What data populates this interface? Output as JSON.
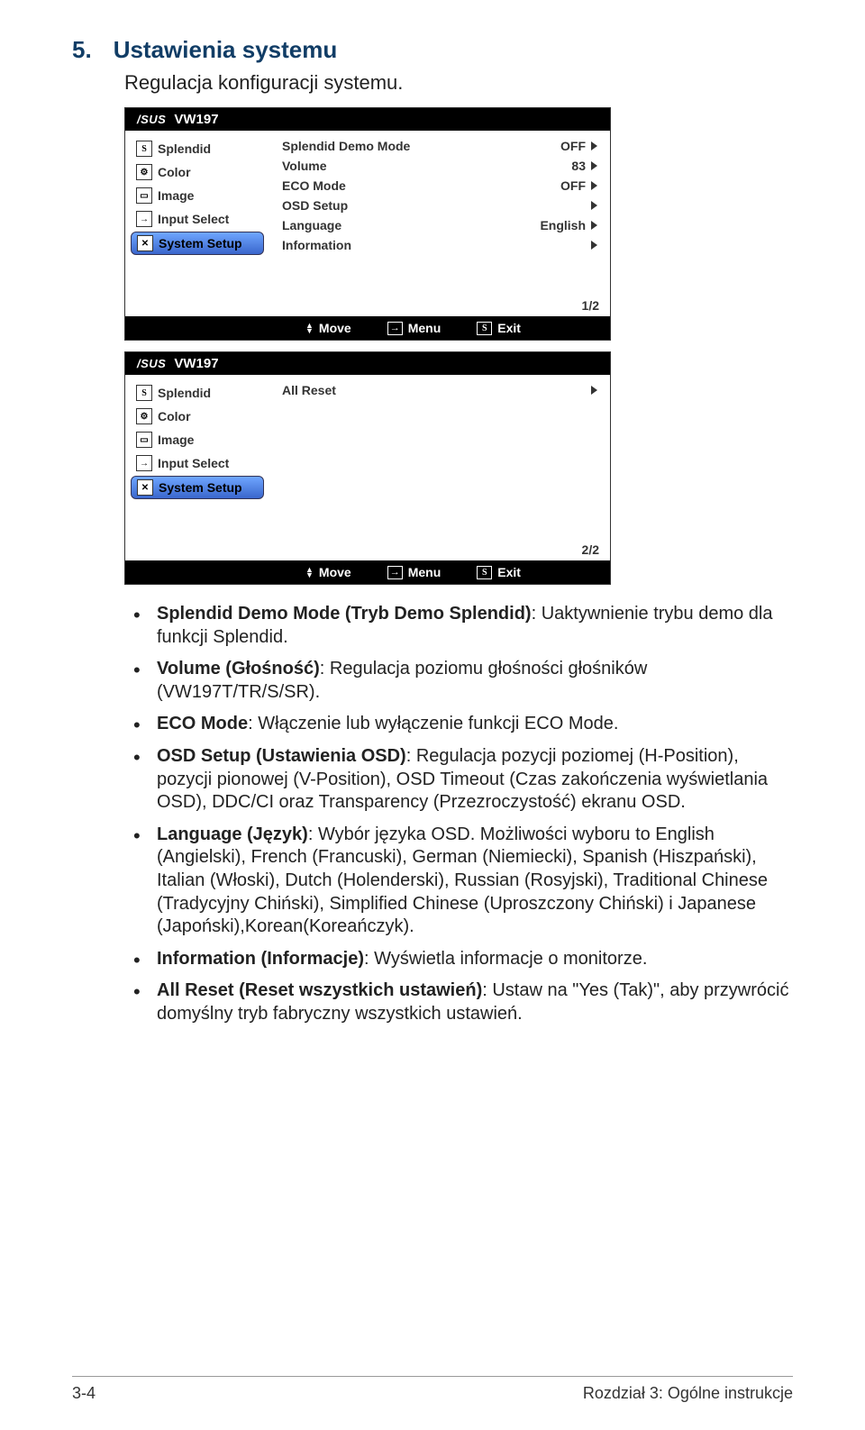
{
  "heading": {
    "num": "5.",
    "title": "Ustawienia systemu"
  },
  "subheading": "Regulacja konfiguracji systemu.",
  "osd": {
    "brand": "/SUS",
    "model": "VW197",
    "sidebar": [
      {
        "icon": "S",
        "label": "Splendid"
      },
      {
        "icon": "⚙",
        "label": "Color"
      },
      {
        "icon": "▭",
        "label": "Image"
      },
      {
        "icon": "→",
        "label": "Input Select"
      },
      {
        "icon": "✕",
        "label": "System Setup",
        "selected": true
      }
    ],
    "panel1": {
      "rows": [
        {
          "label": "Splendid Demo Mode",
          "value": "OFF"
        },
        {
          "label": "Volume",
          "value": "83"
        },
        {
          "label": "ECO Mode",
          "value": "OFF"
        },
        {
          "label": "OSD Setup",
          "value": ""
        },
        {
          "label": "Language",
          "value": "English"
        },
        {
          "label": "Information",
          "value": ""
        }
      ],
      "page": "1/2"
    },
    "panel2": {
      "rows": [
        {
          "label": "All Reset",
          "value": ""
        }
      ],
      "page": "2/2"
    },
    "footer": {
      "move": "Move",
      "menu": "Menu",
      "exit": "Exit"
    }
  },
  "bullets": {
    "b0_strong": "Splendid Demo Mode (Tryb Demo Splendid)",
    "b0_rest": ": Uaktywnienie trybu demo dla funkcji Splendid.",
    "b1_strong": "Volume (Głośność)",
    "b1_rest": ": Regulacja poziomu głośności głośników (VW197T/TR/S/SR).",
    "b2_strong": "ECO Mode",
    "b2_rest": ": Włączenie lub wyłączenie funkcji ECO Mode.",
    "b3_strong": "OSD Setup (Ustawienia OSD)",
    "b3_rest": ": Regulacja pozycji poziomej (H-Position), pozycji pionowej (V-Position), OSD Timeout (Czas zakończenia wyświetlania OSD), DDC/CI oraz Transparency (Przezroczystość) ekranu OSD.",
    "b4_strong": "Language (Język)",
    "b4_rest": ": Wybór języka OSD. Możliwości wyboru to English (Angielski), French (Francuski), German (Niemiecki), Spanish (Hiszpański), Italian (Włoski), Dutch (Holenderski), Russian (Rosyjski), Traditional Chinese (Tradycyjny Chiński), Simplified Chinese (Uproszczony Chiński) i Japanese (Japoński),Korean(Koreańczyk).",
    "b5_strong": "Information (Informacje)",
    "b5_rest": ": Wyświetla informacje o monitorze.",
    "b6_strong": "All Reset (Reset wszystkich ustawień)",
    "b6_rest": ": Ustaw na \"Yes (Tak)\", aby przywrócić domyślny tryb fabryczny wszystkich ustawień."
  },
  "footer": {
    "left": "3-4",
    "right": "Rozdział 3: Ogólne instrukcje"
  }
}
